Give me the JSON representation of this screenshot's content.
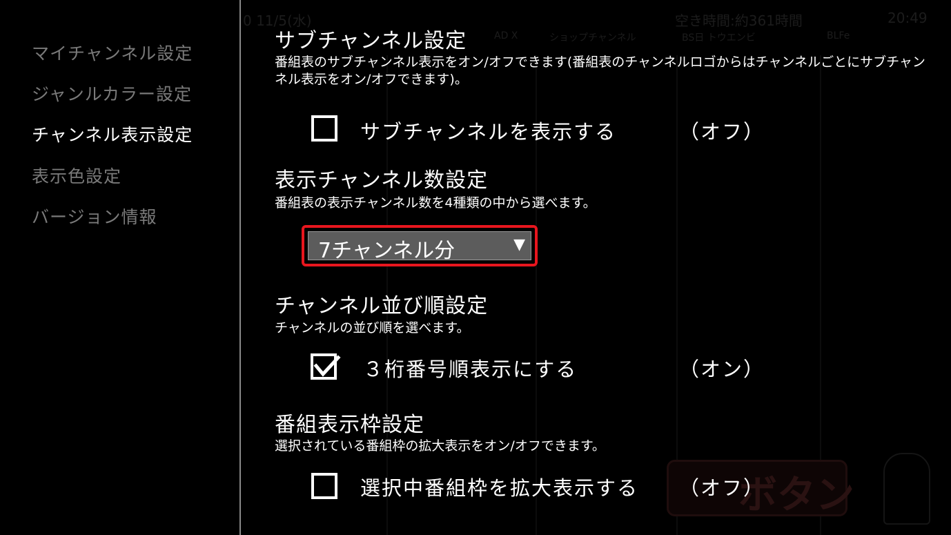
{
  "background": {
    "datetime": "0 11/5(水)",
    "remaining": "空き時間:約361時間",
    "clock": "20:49",
    "channels": [
      "AD X",
      "ショップチャンネル",
      "BS日 トウエンビ",
      "BLFe"
    ],
    "button_text": "ボタン"
  },
  "sidebar": {
    "items": [
      {
        "label": "マイチャンネル設定",
        "active": false
      },
      {
        "label": "ジャンルカラー設定",
        "active": false
      },
      {
        "label": "チャンネル表示設定",
        "active": true
      },
      {
        "label": "表示色設定",
        "active": false
      },
      {
        "label": "バージョン情報",
        "active": false
      }
    ]
  },
  "sections": {
    "subchannel": {
      "title": "サブチャンネル設定",
      "description": "番組表のサブチャンネル表示をオン/オフできます(番組表のチャンネルロゴからはチャンネルごとにサブチャンネル表示をオン/オフできます)。",
      "option_label": "サブチャンネルを表示する",
      "checked": false,
      "state": "（オフ）"
    },
    "channel_count": {
      "title": "表示チャンネル数設定",
      "description": "番組表の表示チャンネル数を4種類の中から選べます。",
      "selected": "7チャンネル分",
      "arrow": "▼"
    },
    "channel_order": {
      "title": "チャンネル並び順設定",
      "description": "チャンネルの並び順を選べます。",
      "option_label": "３桁番号順表示にする",
      "checked": true,
      "state": "（オン）"
    },
    "program_frame": {
      "title": "番組表示枠設定",
      "description": "選択されている番組枠の拡大表示をオン/オフできます。",
      "option_label": "選択中番組枠を拡大表示する",
      "checked": false,
      "state": "（オフ）"
    }
  },
  "colors": {
    "focus_border": "#e8161e",
    "inactive_menu": "#7a7a7a",
    "active_menu": "#ffffff",
    "select_bg": "#5c5c5c"
  }
}
